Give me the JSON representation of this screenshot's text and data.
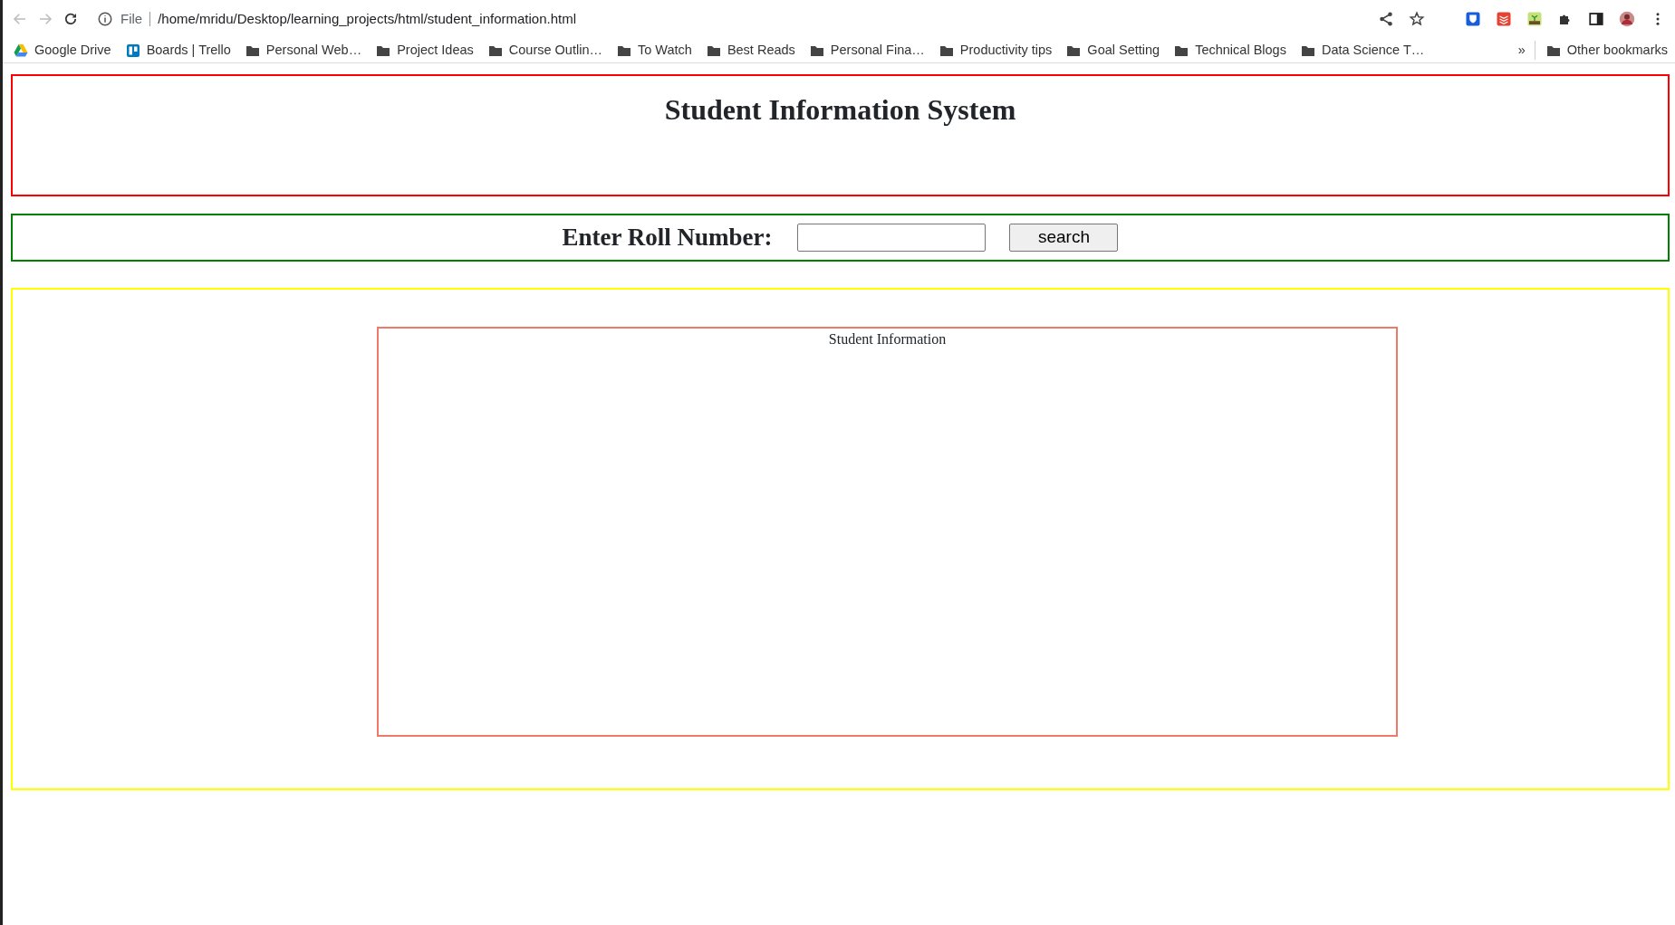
{
  "browser": {
    "scheme_label": "File",
    "url": "/home/mridu/Desktop/learning_projects/html/student_information.html",
    "bookmarks": [
      {
        "kind": "drive",
        "label": "Google Drive"
      },
      {
        "kind": "trello",
        "label": "Boards | Trello"
      },
      {
        "kind": "folder",
        "label": "Personal Web…"
      },
      {
        "kind": "folder",
        "label": "Project Ideas"
      },
      {
        "kind": "folder",
        "label": "Course Outlin…"
      },
      {
        "kind": "folder",
        "label": "To Watch"
      },
      {
        "kind": "folder",
        "label": "Best Reads"
      },
      {
        "kind": "folder",
        "label": "Personal Fina…"
      },
      {
        "kind": "folder",
        "label": "Productivity tips"
      },
      {
        "kind": "folder",
        "label": "Goal Setting"
      },
      {
        "kind": "folder",
        "label": "Technical Blogs"
      },
      {
        "kind": "folder",
        "label": "Data Science T…"
      }
    ],
    "overflow": "»",
    "other_bookmarks": {
      "kind": "folder",
      "label": "Other bookmarks"
    }
  },
  "page": {
    "title": "Student Information System",
    "search_label": "Enter Roll Number:",
    "search_button": "search",
    "info_caption": "Student Information"
  }
}
